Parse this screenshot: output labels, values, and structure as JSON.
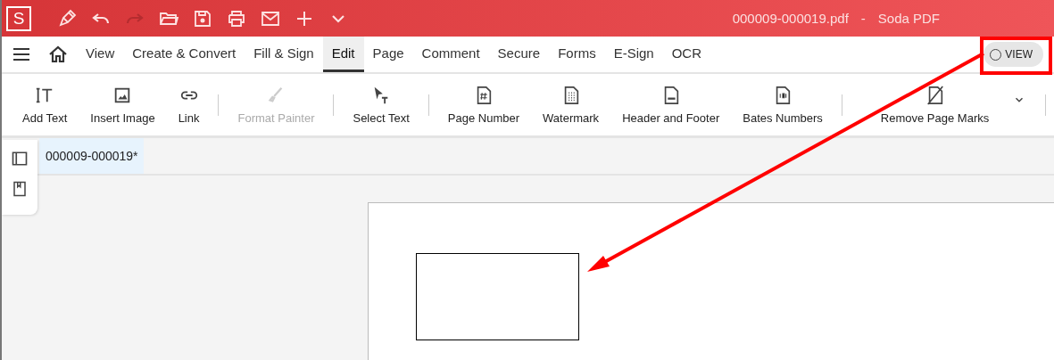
{
  "title_bar": {
    "logo": "S",
    "quick_tools": [
      {
        "kind": "pen",
        "disabled": false
      },
      {
        "kind": "undo",
        "disabled": false
      },
      {
        "kind": "redo",
        "disabled": true
      },
      {
        "kind": "open",
        "disabled": false
      },
      {
        "kind": "save",
        "disabled": false
      },
      {
        "kind": "print",
        "disabled": false
      },
      {
        "kind": "mail",
        "disabled": false
      },
      {
        "kind": "plus",
        "disabled": false
      },
      {
        "kind": "chevron",
        "disabled": false
      }
    ],
    "file_name": "000009-000019.pdf",
    "separator": "-",
    "app_name": "Soda PDF"
  },
  "menu": {
    "tabs": [
      {
        "label": "View",
        "selected": false
      },
      {
        "label": "Create & Convert",
        "selected": false
      },
      {
        "label": "Fill & Sign",
        "selected": false
      },
      {
        "label": "Edit",
        "selected": true
      },
      {
        "label": "Page",
        "selected": false
      },
      {
        "label": "Comment",
        "selected": false
      },
      {
        "label": "Secure",
        "selected": false
      },
      {
        "label": "Forms",
        "selected": false
      },
      {
        "label": "E-Sign",
        "selected": false
      },
      {
        "label": "OCR",
        "selected": false
      }
    ],
    "view_toggle": {
      "label": "VIEW",
      "on": false
    }
  },
  "toolbar": {
    "groups": [
      [
        {
          "label": "Add Text",
          "kind": "text",
          "disabled": false
        },
        {
          "label": "Insert Image",
          "kind": "image",
          "disabled": false
        },
        {
          "label": "Link",
          "kind": "link",
          "disabled": false
        }
      ],
      [
        {
          "label": "Format Painter",
          "kind": "brush",
          "disabled": true
        }
      ],
      [
        {
          "label": "Select Text",
          "kind": "cursor",
          "disabled": false
        }
      ],
      [
        {
          "label": "Page Number",
          "kind": "hash",
          "disabled": false
        },
        {
          "label": "Watermark",
          "kind": "dots",
          "disabled": false
        },
        {
          "label": "Header and Footer",
          "kind": "header",
          "disabled": false
        },
        {
          "label": "Bates Numbers",
          "kind": "bates",
          "disabled": false
        }
      ],
      [
        {
          "label": "Remove Page Marks",
          "kind": "remove",
          "disabled": false
        }
      ]
    ]
  },
  "document_tabs": [
    {
      "label": "000009-000019*",
      "selected": true
    }
  ]
}
